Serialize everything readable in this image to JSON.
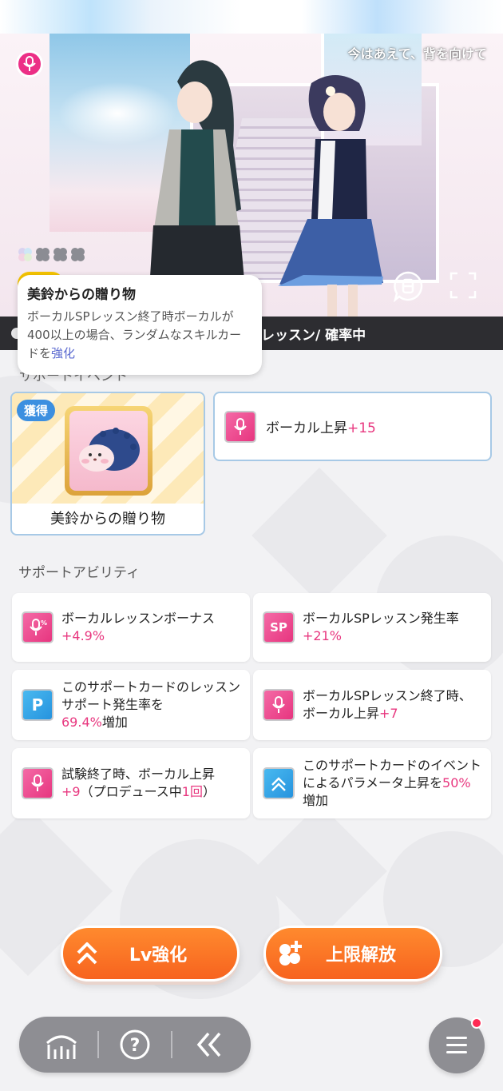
{
  "card": {
    "title": "今はあえて、背を向けて",
    "type_icon": "mic-icon"
  },
  "status_bar": {
    "text": "レッスン/ 確率中"
  },
  "tooltip": {
    "title": "美鈴からの贈り物",
    "body_before": "ボーカルSPレッスン終了時ボーカルが400以上の場合、ランダムなスキルカードを",
    "body_highlight": "強化"
  },
  "support_event": {
    "section_label": "サポートイベント",
    "obtained_badge": "獲得",
    "item_name": "美鈴からの贈り物",
    "vocal_up_label": "ボーカル上昇",
    "vocal_up_value": "+15"
  },
  "abilities": {
    "section_label": "サポートアビリティ",
    "items": [
      {
        "text": "ボーカルレッスンボーナス",
        "value": "+4.9%",
        "after": "",
        "icon": "vocal-lesson-bonus-icon"
      },
      {
        "text": "ボーカルSPレッスン発生率",
        "value": "+21%",
        "after": "",
        "icon": "sp-icon"
      },
      {
        "text": "このサポートカードのレッスンサポート発生率を",
        "value": "69.4%",
        "after": "増加",
        "icon": "lesson-support-icon"
      },
      {
        "text": "ボーカルSPレッスン終了時、ボーカル上昇",
        "value": "+7",
        "after": "",
        "icon": "vocal-up-icon"
      },
      {
        "text_a": "試験終了時、ボーカル上昇",
        "value_a": "+9",
        "text_b": "（プロデュース中",
        "value_b": "1回",
        "text_c": "）",
        "icon": "vocal-up-icon"
      },
      {
        "text": "このサポートカードのイベントによるパラメータ上昇を",
        "value": "50%",
        "after": "増加",
        "icon": "param-up-icon"
      }
    ]
  },
  "buttons": {
    "level_up": "Lv強化",
    "limit_break": "上限解放"
  },
  "nav": {
    "home_icon": "home-icon",
    "help_icon": "help-icon",
    "back_icon": "back-icon",
    "menu_icon": "menu-icon"
  },
  "colors": {
    "accent_pink": "#e8377f",
    "button_orange": "#f7631f",
    "card_border_blue": "#a7c9e6"
  }
}
